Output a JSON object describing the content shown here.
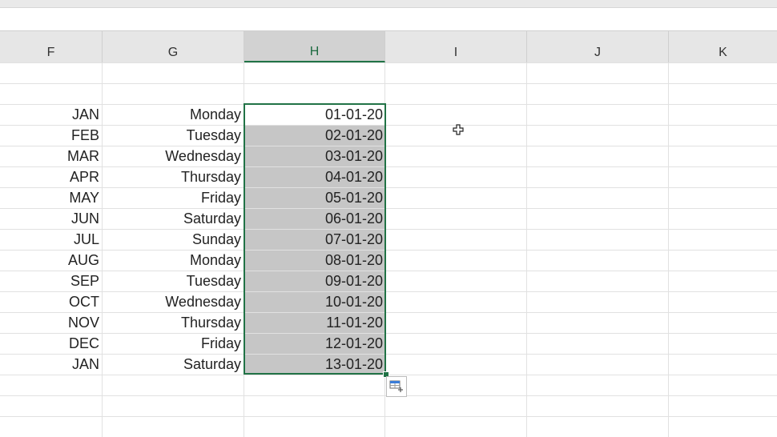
{
  "columns": {
    "f": "F",
    "g": "G",
    "h": "H",
    "i": "I",
    "j": "J",
    "k": "K"
  },
  "rows": [
    {
      "month": "JAN",
      "day": "Monday",
      "date": "01-01-20"
    },
    {
      "month": "FEB",
      "day": "Tuesday",
      "date": "02-01-20"
    },
    {
      "month": "MAR",
      "day": "Wednesday",
      "date": "03-01-20"
    },
    {
      "month": "APR",
      "day": "Thursday",
      "date": "04-01-20"
    },
    {
      "month": "MAY",
      "day": "Friday",
      "date": "05-01-20"
    },
    {
      "month": "JUN",
      "day": "Saturday",
      "date": "06-01-20"
    },
    {
      "month": "JUL",
      "day": "Sunday",
      "date": "07-01-20"
    },
    {
      "month": "AUG",
      "day": "Monday",
      "date": "08-01-20"
    },
    {
      "month": "SEP",
      "day": "Tuesday",
      "date": "09-01-20"
    },
    {
      "month": "OCT",
      "day": "Wednesday",
      "date": "10-01-20"
    },
    {
      "month": "NOV",
      "day": "Thursday",
      "date": "11-01-20"
    },
    {
      "month": "DEC",
      "day": "Friday",
      "date": "12-01-20"
    },
    {
      "month": "JAN",
      "day": "Saturday",
      "date": "13-01-20"
    }
  ],
  "selection": {
    "column": "H",
    "accent_color": "#217346",
    "fill_color": "#c6c6c6"
  },
  "icons": {
    "quick_analysis": "quick-analysis-icon",
    "cursor": "cell-select-cursor-icon"
  }
}
